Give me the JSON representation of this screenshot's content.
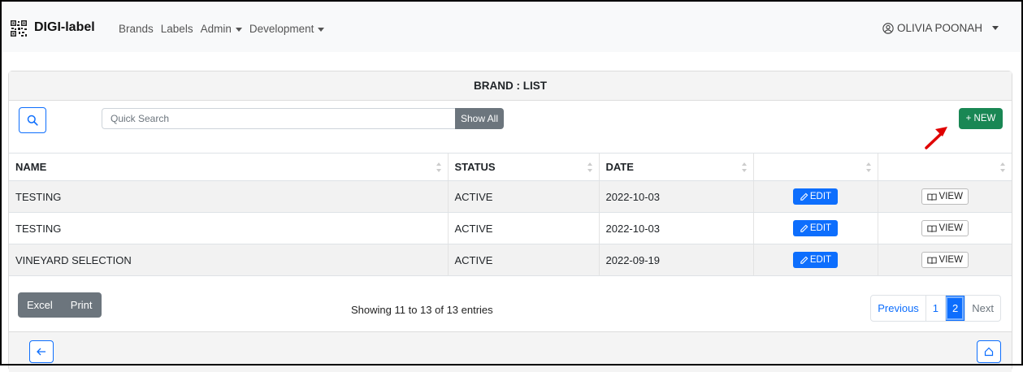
{
  "navbar": {
    "brand": "DIGI-label",
    "links": [
      {
        "label": "Brands",
        "dropdown": false
      },
      {
        "label": "Labels",
        "dropdown": false
      },
      {
        "label": "Admin",
        "dropdown": true
      },
      {
        "label": "Development",
        "dropdown": true
      }
    ],
    "user": "OLIVIA POONAH"
  },
  "card": {
    "title": "BRAND : LIST",
    "search_placeholder": "Quick Search",
    "show_all_label": "Show All",
    "new_label": "+ NEW"
  },
  "table": {
    "headers": [
      "NAME",
      "STATUS",
      "DATE",
      "",
      ""
    ],
    "rows": [
      {
        "name": "TESTING",
        "status": "ACTIVE",
        "date": "2022-10-03",
        "edit": "EDIT",
        "view": "VIEW"
      },
      {
        "name": "TESTING",
        "status": "ACTIVE",
        "date": "2022-10-03",
        "edit": "EDIT",
        "view": "VIEW"
      },
      {
        "name": "VINEYARD SELECTION",
        "status": "ACTIVE",
        "date": "2022-09-19",
        "edit": "EDIT",
        "view": "VIEW"
      }
    ]
  },
  "footer": {
    "excel_label": "Excel",
    "print_label": "Print",
    "entries_info": "Showing 11 to 13 of 13 entries",
    "pagination": {
      "previous": "Previous",
      "pages": [
        "1",
        "2"
      ],
      "active_page": "2",
      "next": "Next"
    }
  },
  "colors": {
    "primary": "#0d6efd",
    "success": "#198754",
    "secondary": "#6c757d",
    "annotation_arrow": "#e00000"
  },
  "icons": [
    "qr-logo-icon",
    "caret-down-icon",
    "user-circle-icon",
    "search-icon",
    "pencil-icon",
    "book-icon",
    "sort-icon",
    "arrow-left-icon",
    "home-icon",
    "annotation-arrow-icon"
  ]
}
